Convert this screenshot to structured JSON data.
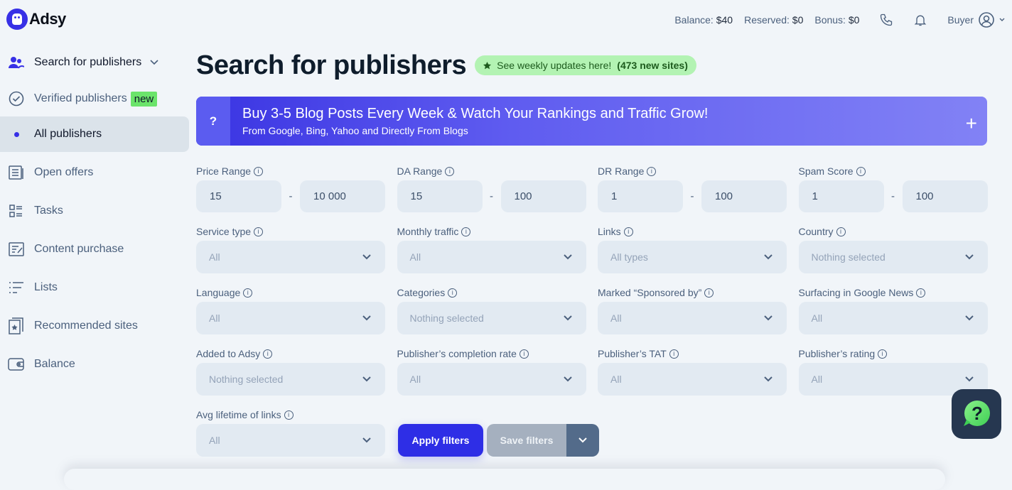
{
  "brand": {
    "name": "Adsy"
  },
  "header": {
    "balance_label": "Balance:",
    "balance_value": "$40",
    "reserved_label": "Reserved:",
    "reserved_value": "$0",
    "bonus_label": "Bonus:",
    "bonus_value": "$0",
    "user_role": "Buyer"
  },
  "sidebar": {
    "items": [
      {
        "label": "Search for publishers",
        "icon": "users-icon"
      },
      {
        "label": "Verified publishers",
        "badge": "new",
        "icon": "check-circle-icon"
      },
      {
        "label": "All publishers",
        "icon": "dot-icon"
      },
      {
        "label": "Open offers",
        "icon": "document-icon"
      },
      {
        "label": "Tasks",
        "icon": "checklist-icon"
      },
      {
        "label": "Content purchase",
        "icon": "edit-document-icon"
      },
      {
        "label": "Lists",
        "icon": "list-icon"
      },
      {
        "label": "Recommended sites",
        "icon": "star-card-icon"
      },
      {
        "label": "Balance",
        "icon": "wallet-icon"
      }
    ]
  },
  "main": {
    "title": "Search for publishers",
    "updates": {
      "text": "See weekly updates here!",
      "count": "(473 new sites)"
    },
    "banner": {
      "question": "?",
      "title": "Buy 3-5 Blog Posts Every Week & Watch Your Rankings and Traffic Grow!",
      "subtitle": "From Google, Bing, Yahoo and Directly From Blogs",
      "expand": "+"
    },
    "ranges": [
      {
        "label": "Price Range",
        "min": "15",
        "max": "10 000"
      },
      {
        "label": "DA Range",
        "min": "15",
        "max": "100"
      },
      {
        "label": "DR Range",
        "min": "1",
        "max": "100"
      },
      {
        "label": "Spam Score",
        "min": "1",
        "max": "100"
      }
    ],
    "selects": [
      {
        "label": "Service type",
        "value": "All"
      },
      {
        "label": "Monthly traffic",
        "value": "All"
      },
      {
        "label": "Links",
        "value": "All types"
      },
      {
        "label": "Country",
        "value": "Nothing selected"
      },
      {
        "label": "Language",
        "value": "All"
      },
      {
        "label": "Categories",
        "value": "Nothing selected"
      },
      {
        "label": "Marked “Sponsored by”",
        "value": "All"
      },
      {
        "label": "Surfacing in Google News",
        "value": "All"
      },
      {
        "label": "Added to Adsy",
        "value": "Nothing selected"
      },
      {
        "label": "Publisher’s completion rate",
        "value": "All"
      },
      {
        "label": "Publisher’s TAT",
        "value": "All"
      },
      {
        "label": "Publisher’s rating",
        "value": "All"
      },
      {
        "label": "Avg lifetime of links",
        "value": "All"
      }
    ],
    "apply_label": "Apply filters",
    "save_label": "Save filters",
    "range_separator": "-",
    "info_glyph": "i"
  },
  "colors": {
    "accent": "#2e2ee6",
    "badge_green": "#6be46b",
    "help_bg": "#263750"
  }
}
